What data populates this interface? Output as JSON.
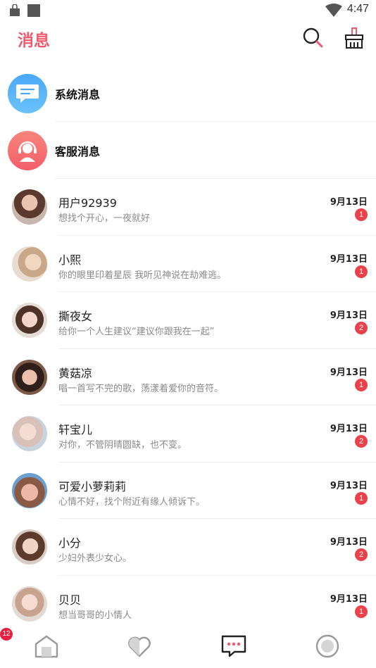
{
  "status_bar": {
    "time": "4:47"
  },
  "header": {
    "title": "消息"
  },
  "system_items": [
    {
      "label": "系统消息"
    },
    {
      "label": "客服消息"
    }
  ],
  "chats": [
    {
      "name": "用户92939",
      "preview": "想找个开心，一夜就好",
      "date": "9月13日",
      "unread": "1"
    },
    {
      "name": "小熙",
      "preview": "你的眼里印着星辰 我听见神说在劫难逃。",
      "date": "9月13日",
      "unread": "1"
    },
    {
      "name": "撕夜女",
      "preview": "给你一个人生建议“建议你跟我在一起”",
      "date": "9月13日",
      "unread": "2"
    },
    {
      "name": "黄菇凉",
      "preview": "唱一首写不完的歌，荡漾着爱你的音符。",
      "date": "9月13日",
      "unread": "1"
    },
    {
      "name": "轩宝儿",
      "preview": "对你，不管阴晴圆缺，也不变。",
      "date": "9月13日",
      "unread": "2"
    },
    {
      "name": "可爱小萝莉莉",
      "preview": "心情不好，找个附近有缘人倾诉下。",
      "date": "9月13日",
      "unread": "1"
    },
    {
      "name": "小分",
      "preview": "少妇外表少女心。",
      "date": "9月13日",
      "unread": "2"
    },
    {
      "name": "贝贝",
      "preview": "想当哥哥的小情人",
      "date": "9月13日",
      "unread": "1"
    }
  ],
  "bottom_nav": {
    "home_badge": "12",
    "items": [
      {
        "icon": "home-icon"
      },
      {
        "icon": "heart-icon"
      },
      {
        "icon": "message-icon"
      },
      {
        "icon": "profile-icon"
      }
    ]
  },
  "colors": {
    "accent": "#f05a6e",
    "badge": "#e9424a",
    "system_blue": "#3d9cf5",
    "service_red": "#f36a6a"
  }
}
